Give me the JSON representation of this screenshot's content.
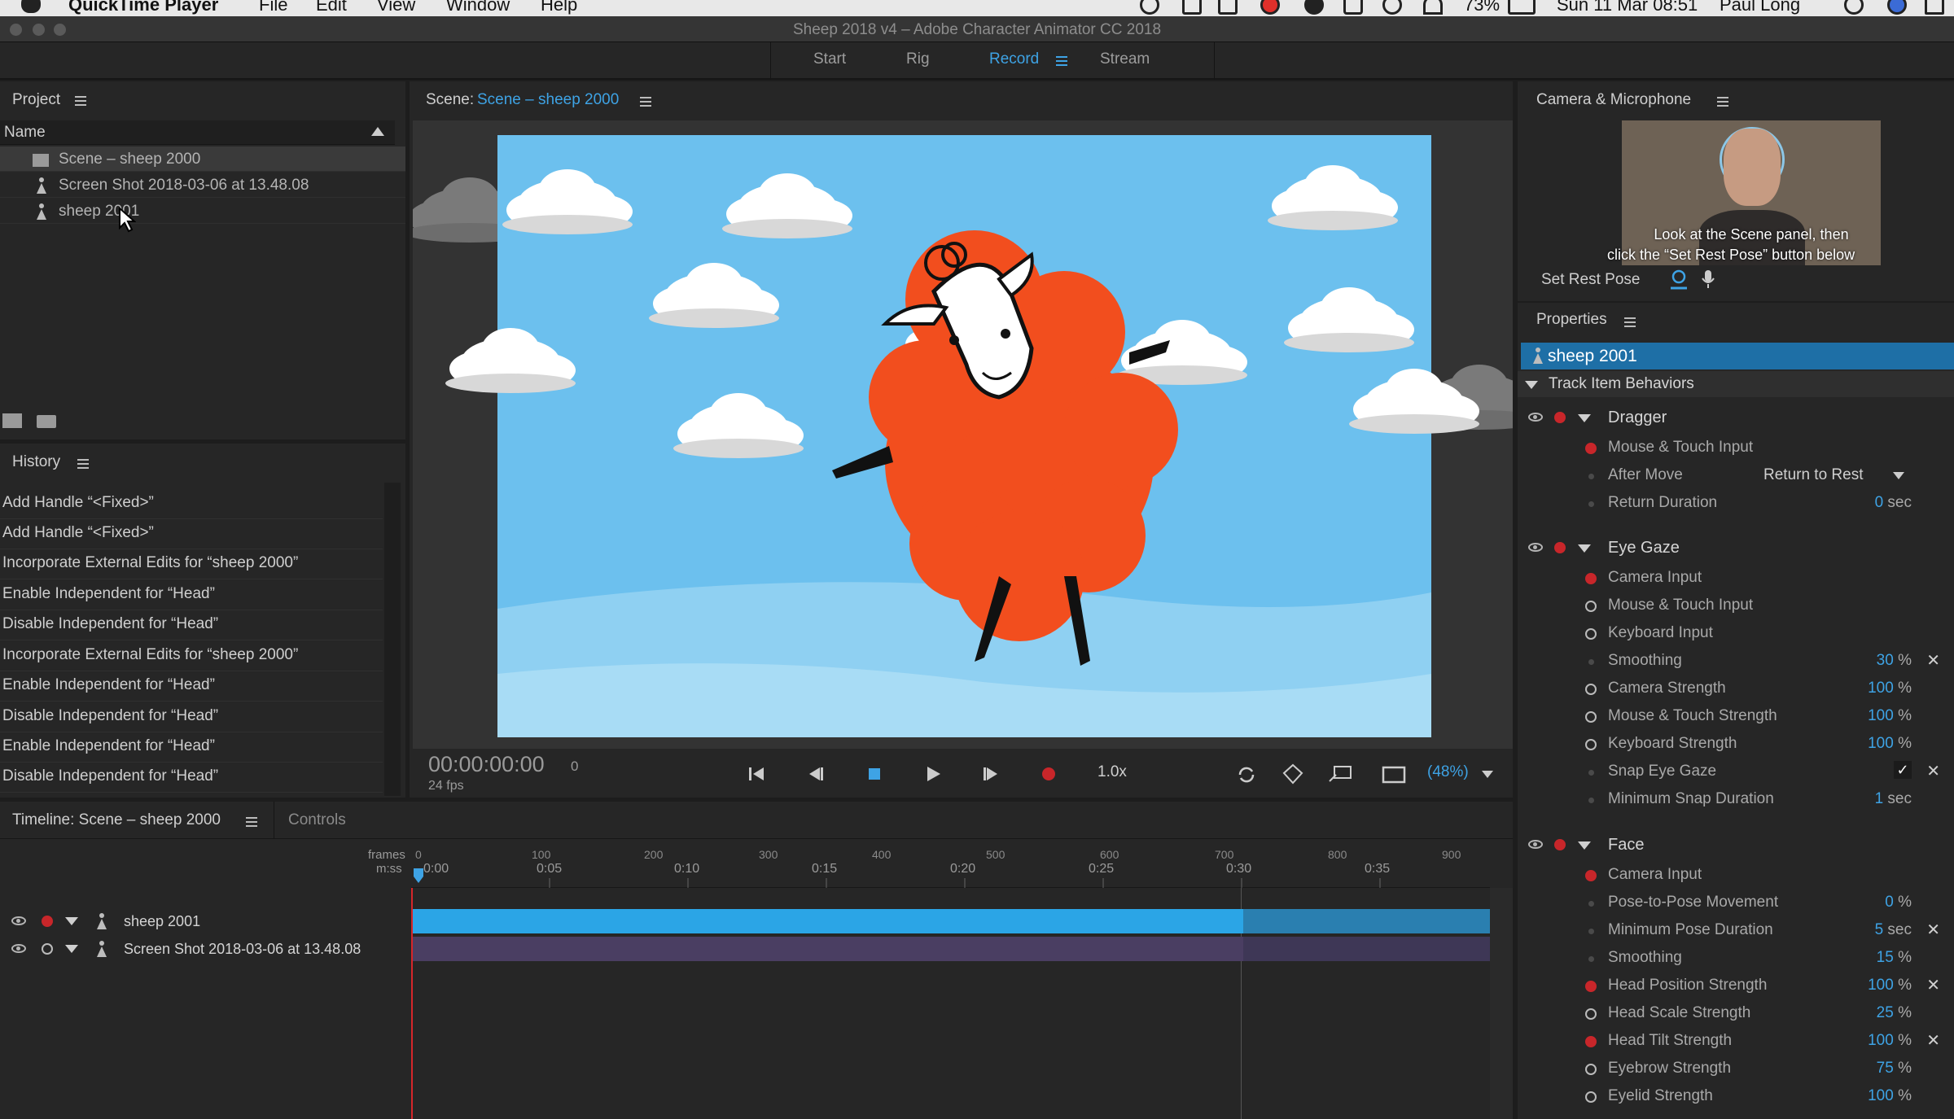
{
  "menubar": {
    "app": "QuickTime Player",
    "items": [
      "File",
      "Edit",
      "View",
      "Window",
      "Help"
    ],
    "battery": "73%",
    "datetime": "Sun 11 Mar  08:51",
    "user": "Paul Long"
  },
  "window": {
    "title": "Sheep 2018 v4 – Adobe Character Animator CC 2018"
  },
  "workspace_tabs": {
    "start": "Start",
    "rig": "Rig",
    "record": "Record",
    "stream": "Stream"
  },
  "project": {
    "title": "Project",
    "column": "Name",
    "items": [
      {
        "label": "Scene – sheep 2000",
        "icon": "scene-icon"
      },
      {
        "label": "Screen Shot 2018-03-06 at 13.48.08",
        "icon": "puppet-icon"
      },
      {
        "label": "sheep 2001",
        "icon": "puppet-icon"
      }
    ]
  },
  "history": {
    "title": "History",
    "items": [
      "Add Handle “<Fixed>”",
      "Add Handle “<Fixed>”",
      "Incorporate External Edits for “sheep 2000”",
      "Enable Independent for “Head”",
      "Disable Independent for “Head”",
      "Incorporate External Edits for “sheep 2000”",
      "Enable Independent for “Head”",
      "Disable Independent for “Head”",
      "Enable Independent for “Head”",
      "Disable Independent for “Head”"
    ]
  },
  "scene": {
    "label": "Scene:",
    "name": "Scene – sheep 2000",
    "timecode": "00:00:00:00",
    "frame": "0",
    "fps": "24 fps",
    "speed": "1.0x",
    "zoom": "(48%)"
  },
  "timeline": {
    "title": "Timeline: Scene – sheep 2000",
    "controls_tab": "Controls",
    "frames_label": "frames",
    "mss_label": "m:ss",
    "frame_ticks": [
      "0",
      "100",
      "200",
      "300",
      "400",
      "500",
      "600",
      "700",
      "800",
      "900"
    ],
    "time_ticks": [
      "0:00",
      "0:05",
      "0:10",
      "0:15",
      "0:20",
      "0:25",
      "0:30",
      "0:35"
    ],
    "tracks": [
      {
        "label": "sheep 2001"
      },
      {
        "label": "Screen Shot 2018-03-06 at 13.48.08"
      }
    ]
  },
  "camera": {
    "title": "Camera & Microphone",
    "hint_line1": "Look at the Scene panel, then",
    "hint_line2": "click the “Set Rest Pose” button below",
    "set_rest_pose": "Set Rest Pose"
  },
  "properties": {
    "title": "Properties",
    "selected": "sheep 2001",
    "section": "Track Item Behaviors",
    "dragger": {
      "name": "Dragger",
      "mouse_touch": "Mouse & Touch Input",
      "after_move": "After Move",
      "after_move_value": "Return to Rest",
      "return_duration": "Return Duration",
      "return_duration_value": "0",
      "return_duration_unit": "sec"
    },
    "eye_gaze": {
      "name": "Eye Gaze",
      "camera_input": "Camera Input",
      "mouse_touch": "Mouse & Touch Input",
      "keyboard_input": "Keyboard Input",
      "smoothing": "Smoothing",
      "smoothing_value": "30",
      "camera_strength": "Camera Strength",
      "camera_strength_value": "100",
      "mouse_strength": "Mouse & Touch Strength",
      "mouse_strength_value": "100",
      "keyboard_strength": "Keyboard Strength",
      "keyboard_strength_value": "100",
      "snap": "Snap Eye Gaze",
      "min_snap": "Minimum Snap Duration",
      "min_snap_value": "1",
      "min_snap_unit": "sec"
    },
    "face": {
      "name": "Face",
      "camera_input": "Camera Input",
      "pose_to_pose": "Pose-to-Pose Movement",
      "pose_to_pose_value": "0",
      "min_pose": "Minimum Pose Duration",
      "min_pose_value": "5",
      "min_pose_unit": "sec",
      "smoothing": "Smoothing",
      "smoothing_value": "15",
      "head_position": "Head Position Strength",
      "head_position_value": "100",
      "head_scale": "Head Scale Strength",
      "head_scale_value": "25",
      "head_tilt": "Head Tilt Strength",
      "head_tilt_value": "100",
      "eyebrow": "Eyebrow Strength",
      "eyebrow_value": "75",
      "eyelid": "Eyelid Strength",
      "eyelid_value": "100"
    },
    "percent_unit": "%"
  },
  "colors": {
    "accent": "#3ea3e5",
    "record_red": "#c8262a",
    "sheep_orange": "#f24e1e",
    "sky": "#6cc0ee"
  }
}
